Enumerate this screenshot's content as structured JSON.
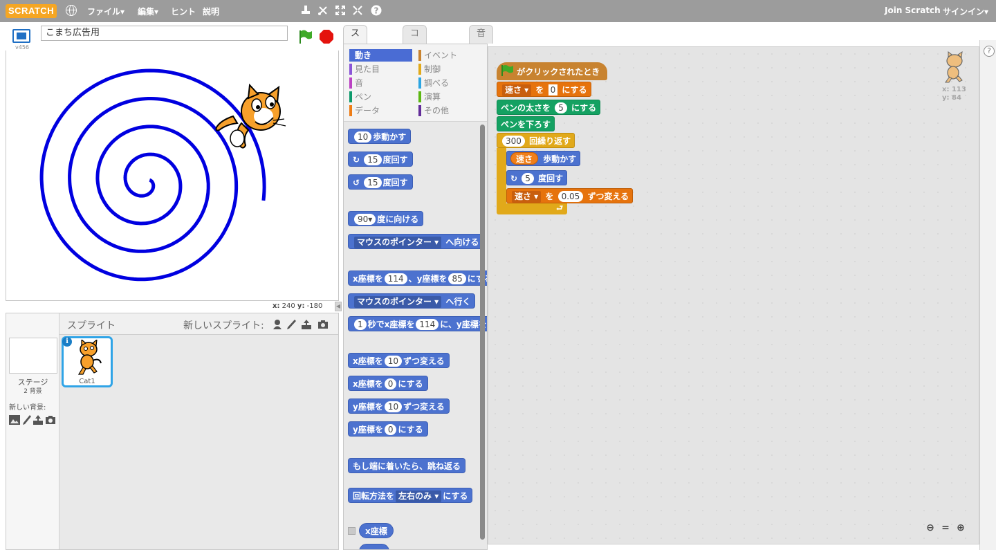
{
  "menubar": {
    "logo": "SCRATCH",
    "file": "ファイル▾",
    "edit": "編集▾",
    "tips": "ヒント",
    "about": "説明",
    "join": "Join Scratch",
    "signin": "サインイン▾",
    "tool_icons": [
      "stamp-icon",
      "scissors-icon",
      "grow-icon",
      "shrink-icon",
      "help-icon"
    ]
  },
  "stage": {
    "project_title": "こまち広告用",
    "version": "v456",
    "mouse_x_label": "x:",
    "mouse_x": "240",
    "mouse_y_label": "y:",
    "mouse_y": "-180",
    "spiral_color": "#0000e0"
  },
  "sprites_pane": {
    "title": "スプライト",
    "new_sprite": "新しいスプライト:",
    "stage_name": "ステージ",
    "stage_backdrops": "2 背景",
    "new_backdrop": "新しい背景:",
    "sprite_name": "Cat1"
  },
  "tabs": [
    "スクリプト",
    "コスチューム",
    "音"
  ],
  "categories": {
    "left": [
      {
        "label": "動き",
        "color": "#4a6cd4",
        "selected": true
      },
      {
        "label": "見た目",
        "color": "#8a55d7"
      },
      {
        "label": "音",
        "color": "#bb42c3"
      },
      {
        "label": "ペン",
        "color": "#0e9a6c"
      },
      {
        "label": "データ",
        "color": "#ee7d16"
      }
    ],
    "right": [
      {
        "label": "イベント",
        "color": "#c88330"
      },
      {
        "label": "制御",
        "color": "#e1a91a"
      },
      {
        "label": "調べる",
        "color": "#2ca5e2"
      },
      {
        "label": "演算",
        "color": "#5cb712"
      },
      {
        "label": "その他",
        "color": "#632d99"
      }
    ]
  },
  "palette": {
    "move": {
      "num": "10",
      "text": "歩動かす"
    },
    "turn_right": {
      "num": "15",
      "text": "度回す"
    },
    "turn_left": {
      "num": "15",
      "text": "度回す"
    },
    "point_dir": {
      "num": "90▾",
      "text": "度に向ける"
    },
    "point_towards": {
      "drop": "マウスのポインター ▾",
      "text": "へ向ける"
    },
    "goto_xy": {
      "t1": "x座標を",
      "x": "114",
      "t2": "、y座標を",
      "y": "85",
      "t3": "にする"
    },
    "goto": {
      "drop": "マウスのポインター ▾",
      "text": "へ行く"
    },
    "glide": {
      "secs": "1",
      "t1": "秒でx座標を",
      "x": "114",
      "t2": "に、y座標を"
    },
    "change_x": {
      "t1": "x座標を",
      "num": "10",
      "t2": "ずつ変える"
    },
    "set_x": {
      "t1": "x座標を",
      "num": "0",
      "t2": "にする"
    },
    "change_y": {
      "t1": "y座標を",
      "num": "10",
      "t2": "ずつ変える"
    },
    "set_y": {
      "t1": "y座標を",
      "num": "0",
      "t2": "にする"
    },
    "bounce": "もし端に着いたら、跳ね返る",
    "rotation_style": {
      "t1": "回転方法を",
      "drop": "左右のみ ▾",
      "t2": "にする"
    },
    "x_position": "x座標"
  },
  "script": {
    "hat": "がクリックされたとき",
    "set_var": {
      "drop": "速さ ▾",
      "t1": "を",
      "val": "0",
      "t2": "にする"
    },
    "pen_size": {
      "t1": "ペンの太さを",
      "val": "5",
      "t2": "にする"
    },
    "pen_down": "ペンを下ろす",
    "repeat": {
      "val": "300",
      "t1": "回繰り返す"
    },
    "move": {
      "var": "速さ",
      "t1": "歩動かす"
    },
    "turn": {
      "val": "5",
      "t1": "度回す"
    },
    "change_var": {
      "drop": "速さ ▾",
      "t1": "を",
      "val": "0.05",
      "t2": "ずつ変える"
    },
    "loop_arrow": "⮐"
  },
  "sprite_info": {
    "x_label": "x:",
    "x": "113",
    "y_label": "y:",
    "y": "84"
  },
  "help": "?"
}
